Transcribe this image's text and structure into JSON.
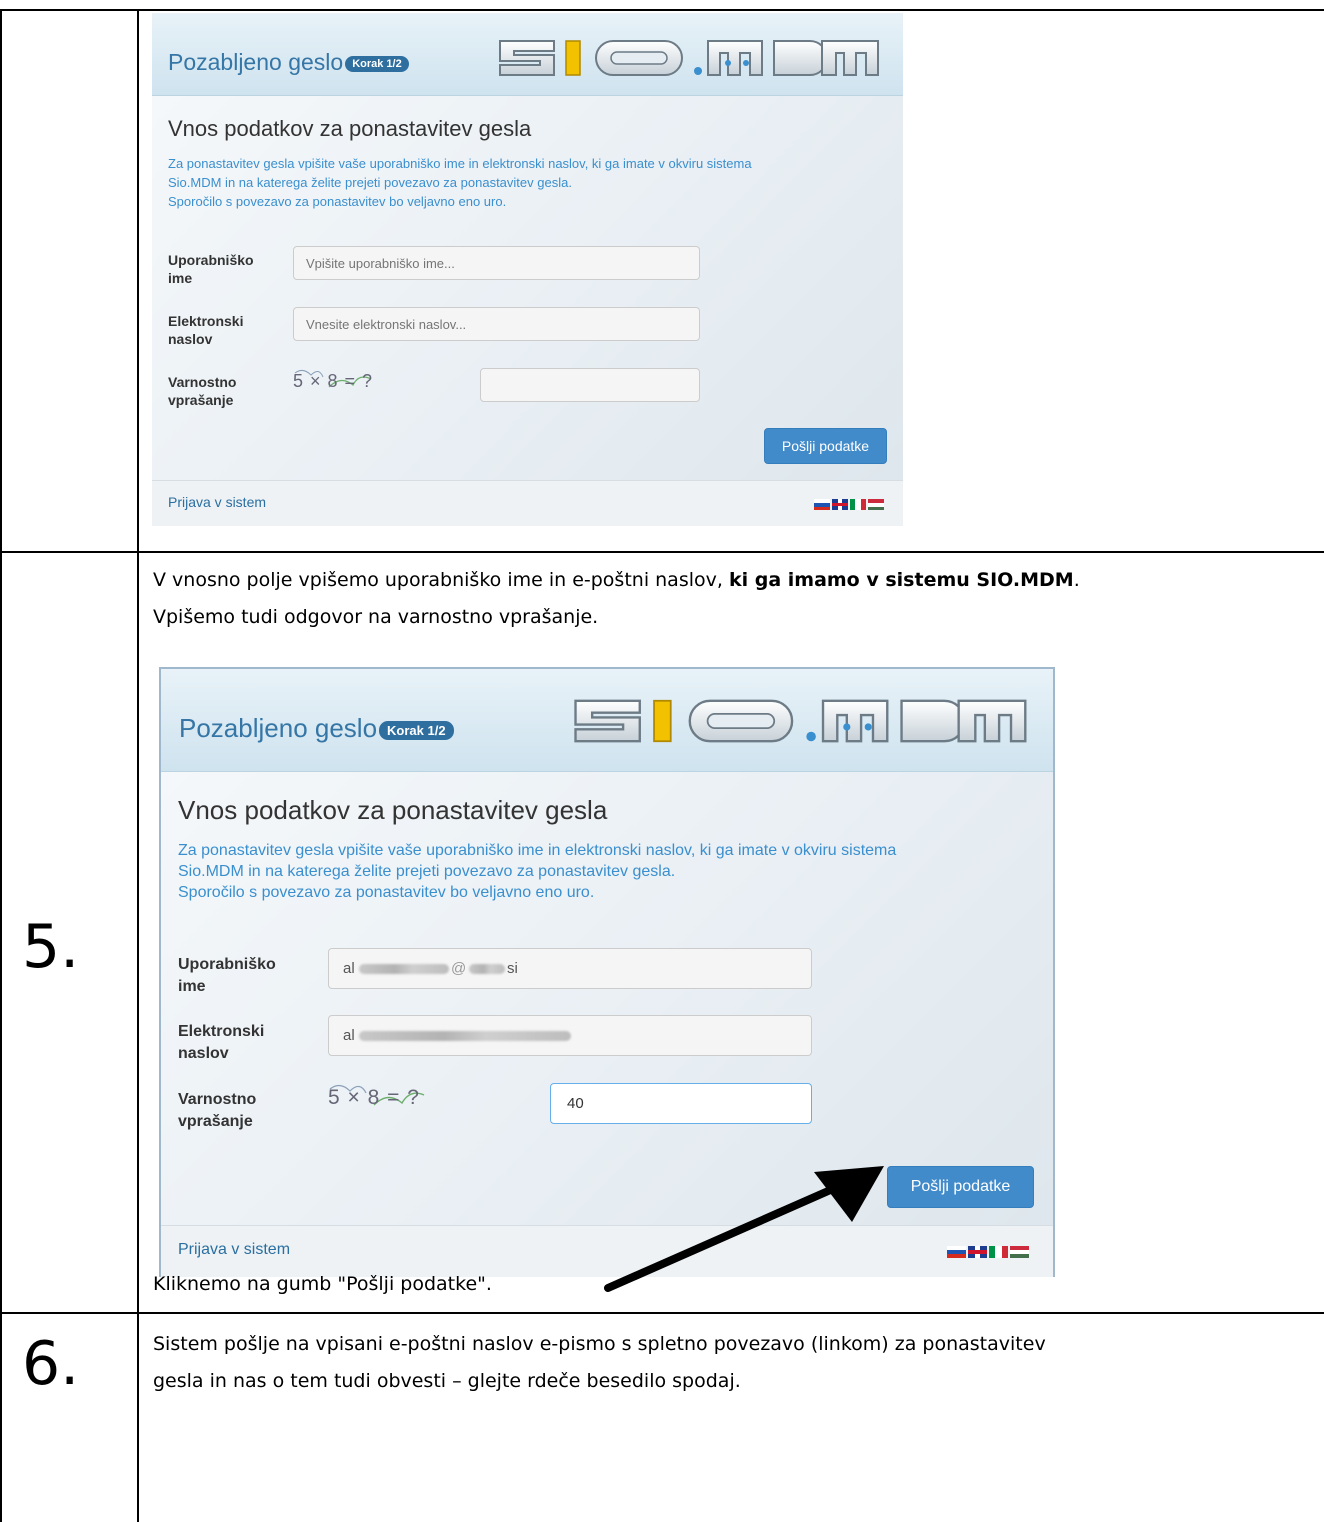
{
  "screenshot_top": {
    "header_title": "Pozabljeno geslo",
    "badge": "Korak 1/2",
    "logo_text": "SIO.MDM",
    "heading": "Vnos podatkov za ponastavitev gesla",
    "info_lines": [
      "Za ponastavitev gesla vpišite vaše uporabniško ime in elektronski naslov, ki ga imate v okviru sistema",
      "Sio.MDM in na katerega želite prejeti povezavo za ponastavitev gesla.",
      "Sporočilo s povezavo za ponastavitev bo veljavno eno uro."
    ],
    "fields": {
      "username_label": [
        "Uporabniško",
        "ime"
      ],
      "username_placeholder": "Vpišite uporabniško ime...",
      "email_label": [
        "Elektronski",
        "naslov"
      ],
      "email_placeholder": "Vnesite elektronski naslov...",
      "security_label": [
        "Varnostno",
        "vprašanje"
      ],
      "captcha_text": "5 × 8 = ?",
      "security_value": ""
    },
    "submit_label": "Pošlji podatke",
    "footer_link": "Prijava v sistem"
  },
  "step5": {
    "number": "5.",
    "intro_prefix": "V vnosno polje vpišemo uporabniško ime in e-poštni naslov, ",
    "intro_bold": "ki ga imamo v sistemu SIO.MDM",
    "intro_suffix": ".",
    "intro_line2": "Vpišemo tudi odgovor na varnostno vprašanje.",
    "screenshot": {
      "header_title": "Pozabljeno geslo",
      "badge": "Korak 1/2",
      "logo_text": "SIO.MDM",
      "heading": "Vnos podatkov za ponastavitev gesla",
      "info_lines": [
        "Za ponastavitev gesla vpišite vaše uporabniško ime in elektronski naslov, ki ga imate v okviru sistema",
        "Sio.MDM in na katerega želite prejeti povezavo za ponastavitev gesla.",
        "Sporočilo s povezavo za ponastavitev bo veljavno eno uro."
      ],
      "fields": {
        "username_label": [
          "Uporabniško",
          "ime"
        ],
        "username_value_start": "al",
        "username_value_at": "@",
        "username_value_end": "si",
        "email_label": [
          "Elektronski",
          "naslov"
        ],
        "email_value_start": "al",
        "security_label": [
          "Varnostno",
          "vprašanje"
        ],
        "captcha_text": "5 × 8 = ?",
        "security_value": "40"
      },
      "submit_label": "Pošlji podatke",
      "footer_link": "Prijava v sistem"
    },
    "outro": "Kliknemo na gumb \"Pošlji podatke\"."
  },
  "step6": {
    "number": "6.",
    "text_line1": "Sistem pošlje na vpisani e-poštni naslov e-pismo s spletno povezavo (linkom) za ponastavitev",
    "text_line2": "gesla in nas o tem tudi obvesti – glejte rdeče besedilo spodaj."
  },
  "colors": {
    "accent_blue": "#428bca",
    "info_blue": "#3a8fce",
    "header_blue": "#3576a6",
    "logo_yellow": "#f2c200"
  }
}
